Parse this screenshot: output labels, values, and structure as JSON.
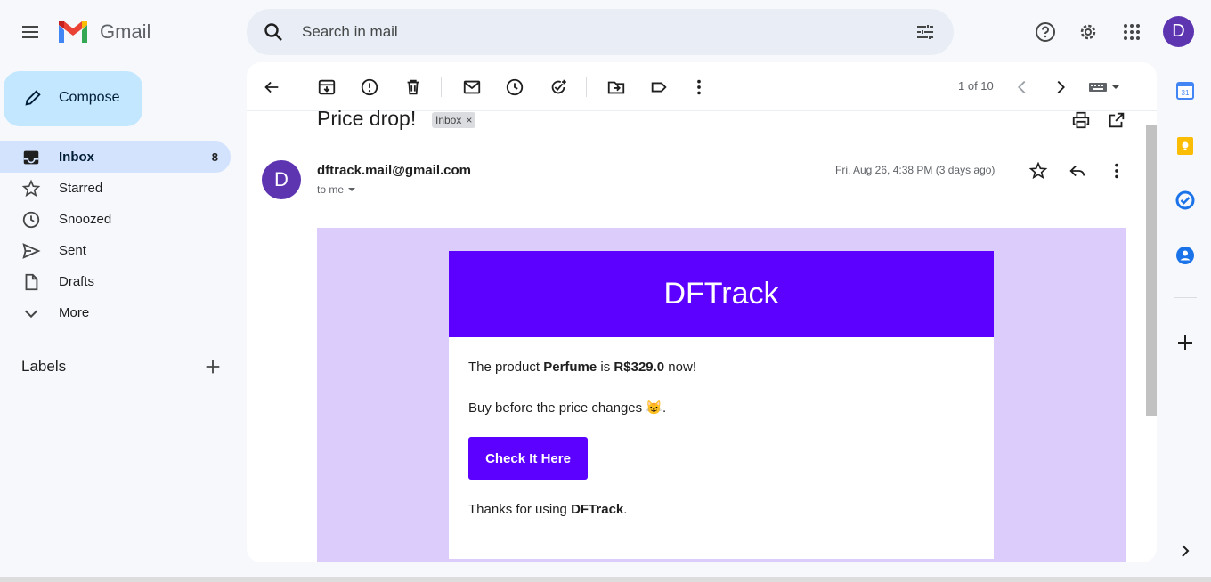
{
  "header": {
    "app_name": "Gmail",
    "search_placeholder": "Search in mail",
    "avatar_letter": "D"
  },
  "sidebar": {
    "compose_label": "Compose",
    "items": [
      {
        "label": "Inbox",
        "count": "8",
        "icon": "inbox-icon",
        "active": true
      },
      {
        "label": "Starred",
        "icon": "star-icon"
      },
      {
        "label": "Snoozed",
        "icon": "clock-icon"
      },
      {
        "label": "Sent",
        "icon": "send-icon"
      },
      {
        "label": "Drafts",
        "icon": "draft-icon"
      },
      {
        "label": "More",
        "icon": "chevron-down-icon"
      }
    ],
    "labels_heading": "Labels"
  },
  "toolbar": {
    "pager_text": "1 of 10"
  },
  "message": {
    "subject": "Price drop!",
    "label_chip": "Inbox",
    "sender_letter": "D",
    "sender_email": "dftrack.mail@gmail.com",
    "recipient_text": "to me",
    "date_text": "Fri, Aug 26, 4:38 PM (3 days ago)"
  },
  "email": {
    "brand": "DFTrack",
    "line1_prefix": "The product ",
    "product": "Perfume",
    "line1_mid": " is ",
    "price": "R$329.0",
    "line1_suffix": " now!",
    "line2": "Buy before the price changes ",
    "emoji": "😺",
    "line2_end": ".",
    "cta_label": "Check It Here",
    "thanks_prefix": "Thanks for using ",
    "thanks_brand": "DFTrack",
    "thanks_suffix": "."
  },
  "colors": {
    "email_background": "#dcccfc",
    "brand_purple": "#5c00ff",
    "avatar_purple": "#5e35b1",
    "active_nav": "#d3e3fd",
    "compose_bg": "#c2e7ff"
  }
}
